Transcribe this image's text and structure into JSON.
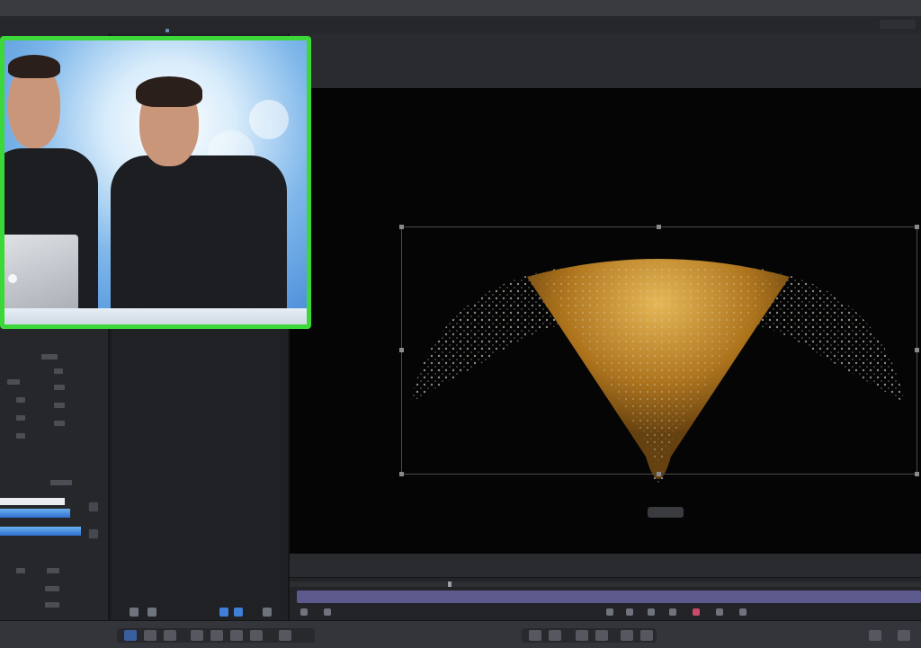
{
  "window": {
    "title": ""
  },
  "viewer": {
    "object_label": "",
    "particle_color": "#e0a030"
  },
  "colors": {
    "webcam_border": "#3cd83a",
    "accent_blue": "#3f7fd9",
    "clip_purple": "#5c5a8c"
  },
  "icons": {
    "playhead": "playhead-icon",
    "apple_logo": "apple-logo-icon"
  }
}
